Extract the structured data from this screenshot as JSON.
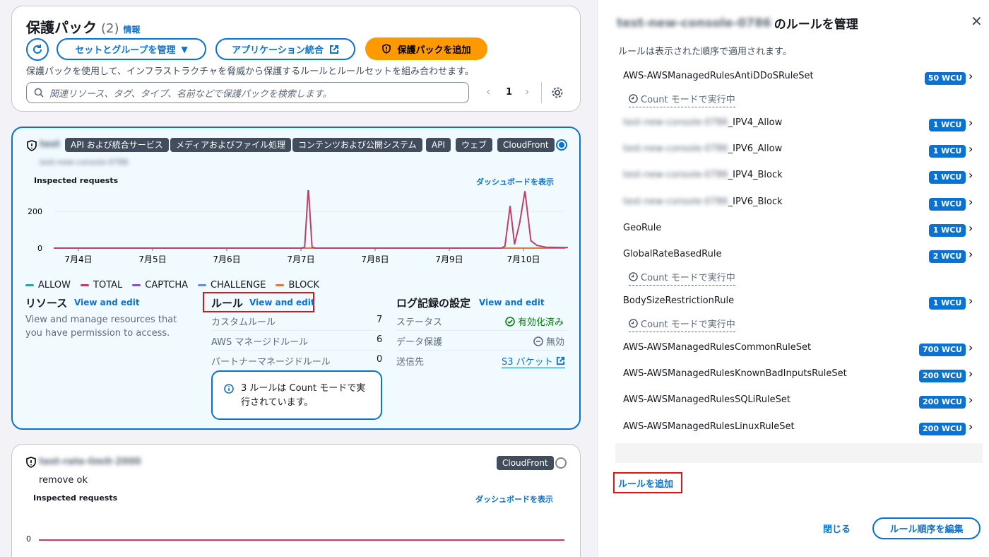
{
  "header": {
    "title": "保護パック",
    "count": "(2)",
    "info_link": "情報",
    "sets_groups_btn": "セットとグループを管理",
    "app_integration_btn": "アプリケーション統合",
    "add_pack_btn": "保護パックを追加",
    "description": "保護パックを使用して、インフラストラクチャを脅威から保護するルールとルールセットを組み合わせます。",
    "search_placeholder": "関連リソース、タグ、タイプ、名前などで保護パックを検索します。",
    "page_number": "1"
  },
  "pack1": {
    "name": "test",
    "subname": "test-new-console-0786",
    "tags": [
      "API および統合サービス",
      "メディアおよびファイル処理",
      "コンテンツおよび公開システム",
      "API",
      "ウェブ",
      "CloudFront"
    ],
    "inspected_label": "Inspected requests",
    "dashboard_link": "ダッシュボードを表示",
    "legend": [
      {
        "name": "ALLOW",
        "color": "#2ea597"
      },
      {
        "name": "TOTAL",
        "color": "#c33d69"
      },
      {
        "name": "CAPTCHA",
        "color": "#8456ce"
      },
      {
        "name": "CHALLENGE",
        "color": "#688ae8"
      },
      {
        "name": "BLOCK",
        "color": "#e07941"
      }
    ],
    "resources_title": "リソース",
    "resources_link": "View and edit",
    "resources_desc": "View and manage resources that you have permission to access.",
    "rules_title": "ルール",
    "rules_link": "View and edit",
    "rules_rows": [
      {
        "label": "カスタムルール",
        "value": "7"
      },
      {
        "label": "AWS マネージドルール",
        "value": "6"
      },
      {
        "label": "パートナーマネージドルール",
        "value": "0"
      }
    ],
    "rules_info": "3 ルールは Count モードで実行されています。",
    "logging_title": "ログ記録の設定",
    "logging_link": "View and edit",
    "logging_rows": [
      {
        "label": "ステータス",
        "value": "有効化済み"
      },
      {
        "label": "データ保護",
        "value": "無効"
      },
      {
        "label": "送信先",
        "value": "S3 バケット"
      }
    ]
  },
  "pack2": {
    "name": "test-rate-limit-2000",
    "tag": "CloudFront",
    "subtitle": "remove ok",
    "inspected_label": "Inspected requests",
    "dashboard_link": "ダッシュボードを表示",
    "y0": "0"
  },
  "chart_data": {
    "type": "line",
    "title": "Inspected requests",
    "categories": [
      "7月4日",
      "7月5日",
      "7月6日",
      "7月7日",
      "7月8日",
      "7月9日",
      "7月10日"
    ],
    "yticks": [
      "0",
      "200"
    ],
    "ylim": [
      0,
      300
    ],
    "series": [
      {
        "name": "TOTAL",
        "color": "#c33d69",
        "points": [
          [
            0,
            0
          ],
          [
            3.0,
            0
          ],
          [
            3.05,
            5
          ],
          [
            3.1,
            330
          ],
          [
            3.15,
            5
          ],
          [
            3.2,
            0
          ],
          [
            5.7,
            0
          ],
          [
            5.75,
            10
          ],
          [
            5.82,
            230
          ],
          [
            5.88,
            20
          ],
          [
            5.95,
            140
          ],
          [
            6.02,
            310
          ],
          [
            6.1,
            40
          ],
          [
            6.18,
            15
          ],
          [
            6.3,
            5
          ],
          [
            6.6,
            3
          ],
          [
            7.0,
            3
          ]
        ]
      },
      {
        "name": "BLOCK",
        "color": "#e07941",
        "points": [
          [
            0,
            0
          ],
          [
            7.0,
            0
          ]
        ]
      }
    ]
  },
  "panel": {
    "title_blurred": "test-new-console-0786",
    "title_suffix": "のルールを管理",
    "subtitle": "ルールは表示された順序で適用されます。",
    "count_mode_label": "Count モードで実行中",
    "rules": [
      {
        "name": "AWS-AWSManagedRulesAntiDDoSRuleSet",
        "blur_prefix": "",
        "wcu": "50 WCU",
        "count": true
      },
      {
        "name": "_IPV4_Allow",
        "blur_prefix": "test-new-console-0786",
        "wcu": "1 WCU",
        "count": false
      },
      {
        "name": "_IPV6_Allow",
        "blur_prefix": "test-new-console-0786",
        "wcu": "1 WCU",
        "count": false
      },
      {
        "name": "_IPV4_Block",
        "blur_prefix": "test-new-console-0786",
        "wcu": "1 WCU",
        "count": false
      },
      {
        "name": "_IPV6_Block",
        "blur_prefix": "test-new-console-0786",
        "wcu": "1 WCU",
        "count": false
      },
      {
        "name": "GeoRule",
        "blur_prefix": "",
        "wcu": "1 WCU",
        "count": false
      },
      {
        "name": "GlobalRateBasedRule",
        "blur_prefix": "",
        "wcu": "2 WCU",
        "count": true
      },
      {
        "name": "BodySizeRestrictionRule",
        "blur_prefix": "",
        "wcu": "1 WCU",
        "count": true
      },
      {
        "name": "AWS-AWSManagedRulesCommonRuleSet",
        "blur_prefix": "",
        "wcu": "700 WCU",
        "count": false
      },
      {
        "name": "AWS-AWSManagedRulesKnownBadInputsRuleSet",
        "blur_prefix": "",
        "wcu": "200 WCU",
        "count": false
      },
      {
        "name": "AWS-AWSManagedRulesSQLiRuleSet",
        "blur_prefix": "",
        "wcu": "200 WCU",
        "count": false
      },
      {
        "name": "AWS-AWSManagedRulesLinuxRuleSet",
        "blur_prefix": "",
        "wcu": "200 WCU",
        "count": false
      }
    ],
    "add_rule_link": "ルールを追加",
    "close_btn": "閉じる",
    "edit_order_btn": "ルール順序を編集"
  }
}
